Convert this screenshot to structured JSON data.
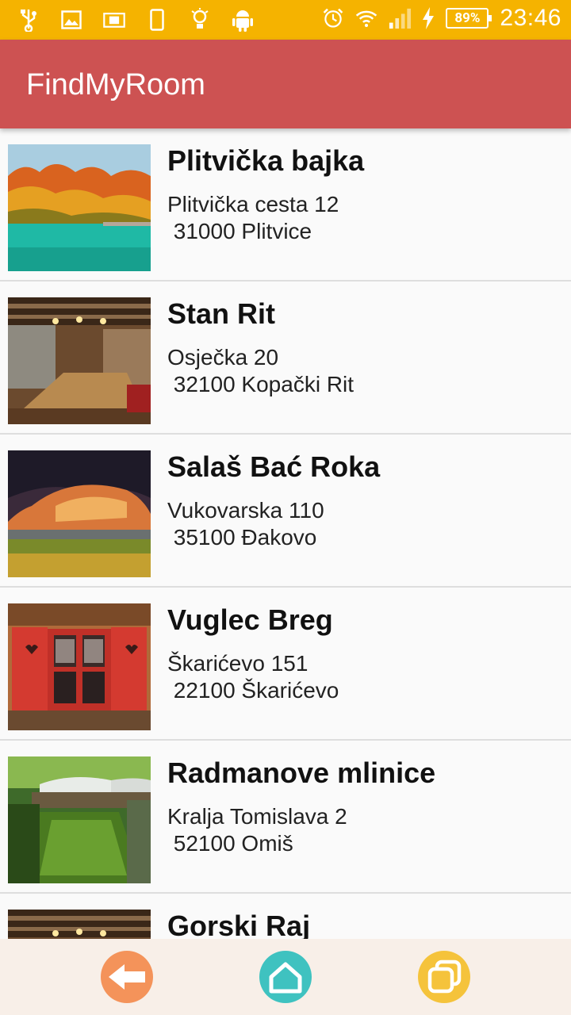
{
  "status_bar": {
    "time": "23:46",
    "battery": "89%",
    "left_icons": [
      "usb-icon",
      "image-icon",
      "notification-icon",
      "phone-icon",
      "lightbulb-icon",
      "android-icon"
    ],
    "right_icons": [
      "alarm-icon",
      "wifi-icon",
      "signal-icon",
      "charging-icon",
      "battery-icon"
    ]
  },
  "app_bar": {
    "title": "FindMyRoom"
  },
  "listings": [
    {
      "name": "Plitvička bajka",
      "street": "Plitvička cesta 12",
      "city": " 31000 Plitvice",
      "image": "lake-autumn"
    },
    {
      "name": "Stan Rit",
      "street": "Osječka 20",
      "city": " 32100 Kopački Rit",
      "image": "rustic-dining-room"
    },
    {
      "name": "Salaš Bać Roka",
      "street": "Vukovarska 110",
      "city": " 35100 Đakovo",
      "image": "sunset-field"
    },
    {
      "name": "Vuglec Breg",
      "street": "Škarićevo 151",
      "city": " 22100 Škarićevo",
      "image": "red-shutter-window"
    },
    {
      "name": "Radmanove mlinice",
      "street": "Kralja Tomislava 2",
      "city": " 52100 Omiš",
      "image": "green-river-restaurant"
    },
    {
      "name": "Gorski Raj",
      "street": "",
      "city": "",
      "image": "rustic-dining-room"
    }
  ],
  "bottom_nav": {
    "items": [
      {
        "name": "back-button",
        "icon": "arrow-left-icon",
        "color": "#f4935a"
      },
      {
        "name": "home-button",
        "icon": "home-icon",
        "color": "#3fc2c0"
      },
      {
        "name": "windows-button",
        "icon": "overlapping-windows-icon",
        "color": "#f5c33b"
      }
    ]
  },
  "colors": {
    "status_bar": "#f5b300",
    "app_bar": "#cd5252",
    "background": "#fafafa",
    "nav_bar": "#f8efe8"
  }
}
